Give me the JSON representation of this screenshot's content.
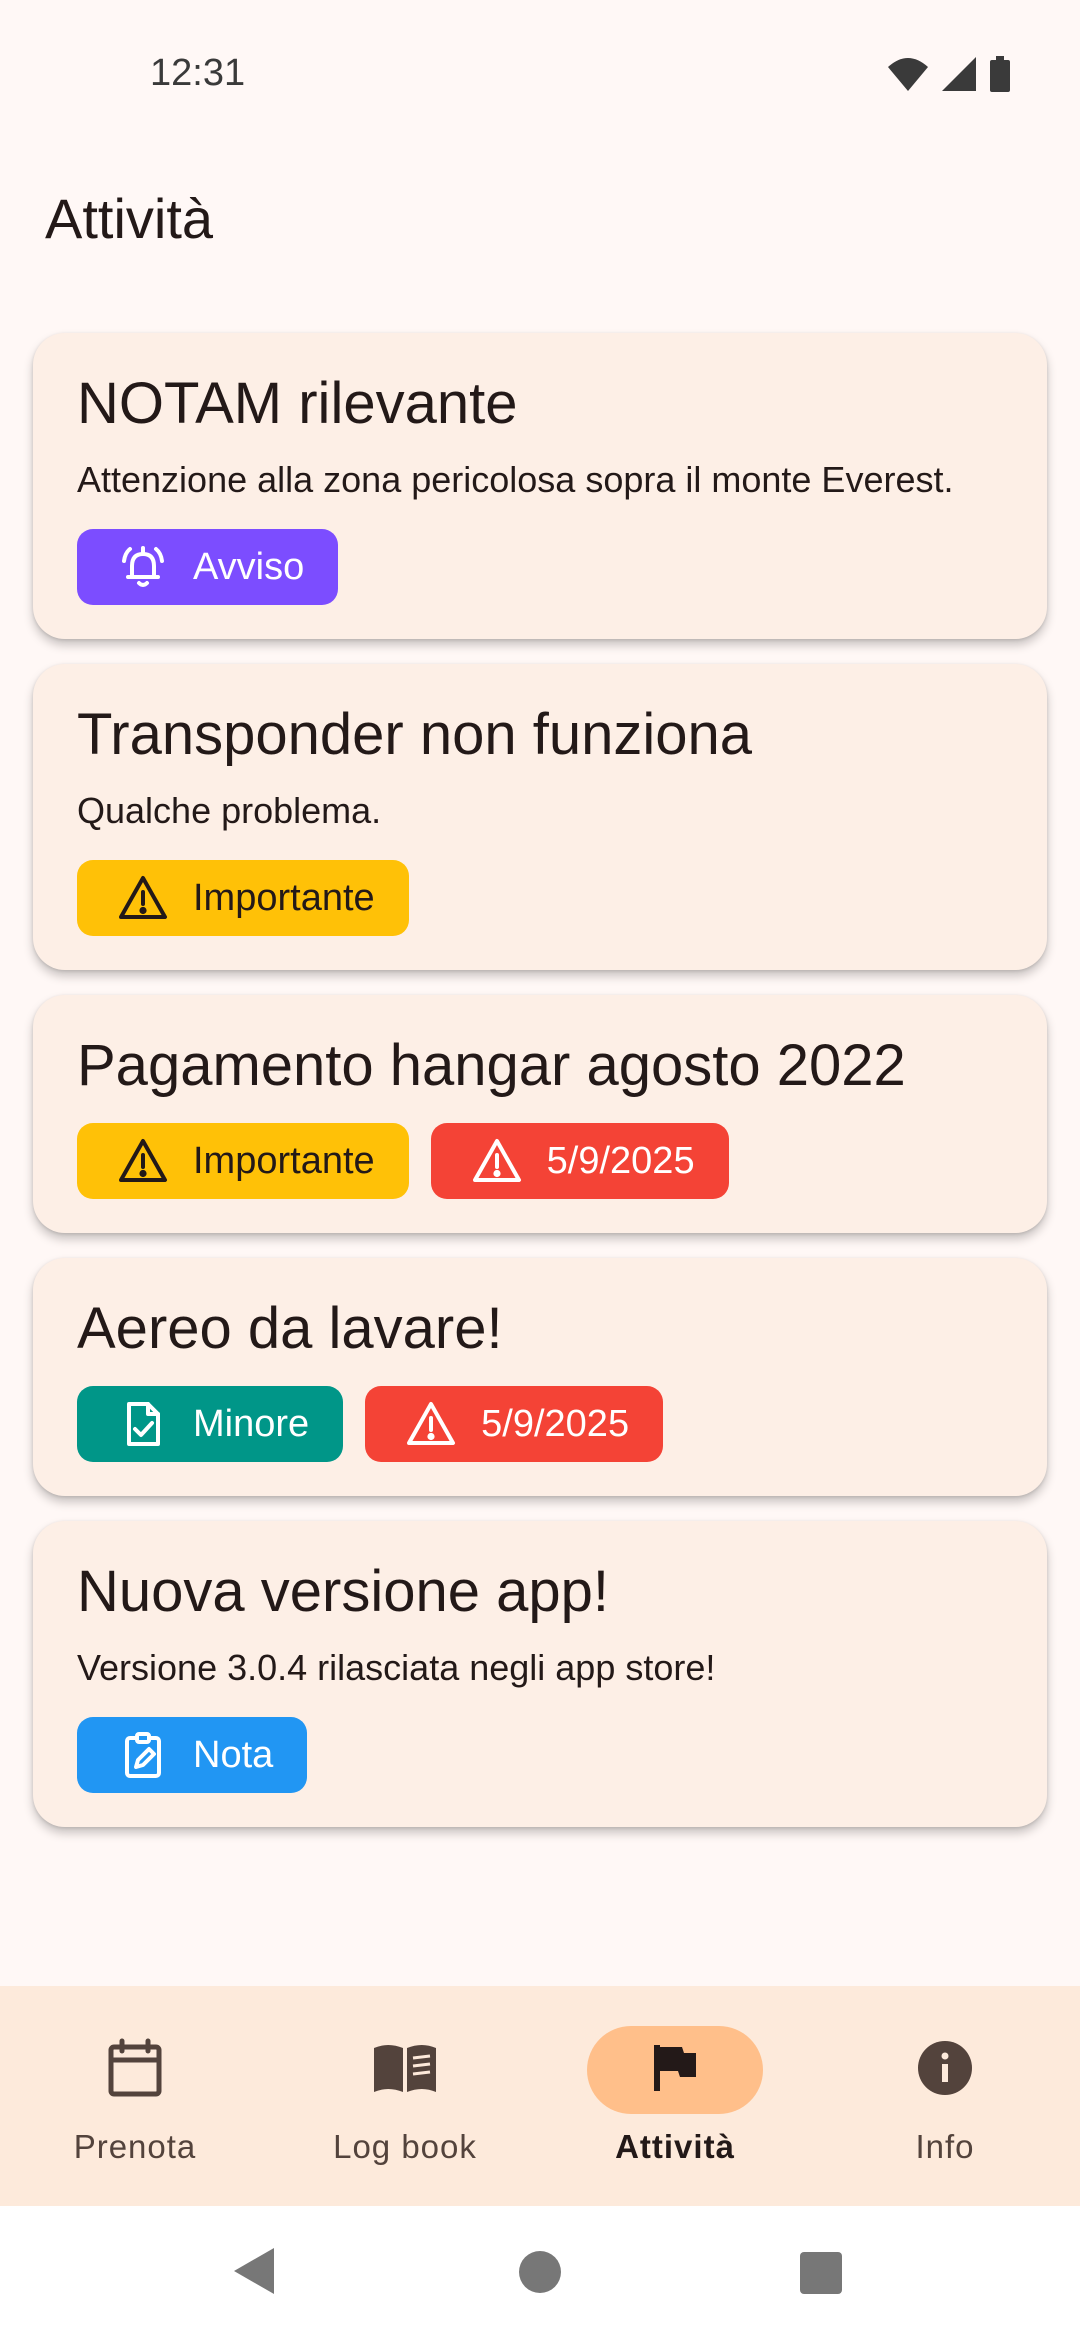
{
  "status_bar": {
    "time": "12:31"
  },
  "page": {
    "title": "Attività"
  },
  "cards": [
    {
      "title": "NOTAM rilevante",
      "description": "Attenzione alla zona pericolosa sopra il monte Everest.",
      "chips": [
        {
          "label": "Avviso",
          "icon": "alarm-bell-icon",
          "color": "#7c4dff"
        }
      ]
    },
    {
      "title": "Transponder non funziona",
      "description": "Qualche problema.",
      "chips": [
        {
          "label": "Importante",
          "icon": "warning-icon",
          "color": "#ffc107"
        }
      ]
    },
    {
      "title": "Pagamento hangar agosto 2022",
      "chips": [
        {
          "label": "Importante",
          "icon": "warning-icon",
          "color": "#ffc107"
        },
        {
          "label": "5/9/2025",
          "icon": "warning-icon",
          "color": "#f44336"
        }
      ]
    },
    {
      "title": "Aereo da lavare!",
      "chips": [
        {
          "label": "Minore",
          "icon": "document-check-icon",
          "color": "#009688"
        },
        {
          "label": "5/9/2025",
          "icon": "warning-icon",
          "color": "#f44336"
        }
      ]
    },
    {
      "title": "Nuova versione app!",
      "description": "Versione 3.0.4 rilasciata negli app store!",
      "chips": [
        {
          "label": "Nota",
          "icon": "clipboard-edit-icon",
          "color": "#2196f3"
        }
      ]
    }
  ],
  "bottom_nav": {
    "items": [
      {
        "label": "Prenota",
        "icon": "calendar-icon"
      },
      {
        "label": "Log book",
        "icon": "book-icon"
      },
      {
        "label": "Attività",
        "icon": "flag-icon",
        "active": true
      },
      {
        "label": "Info",
        "icon": "info-icon"
      }
    ]
  },
  "colors": {
    "card_bg": "#fdefe6",
    "nav_bg": "#fdeadb",
    "nav_active": "#ffbf8a"
  }
}
